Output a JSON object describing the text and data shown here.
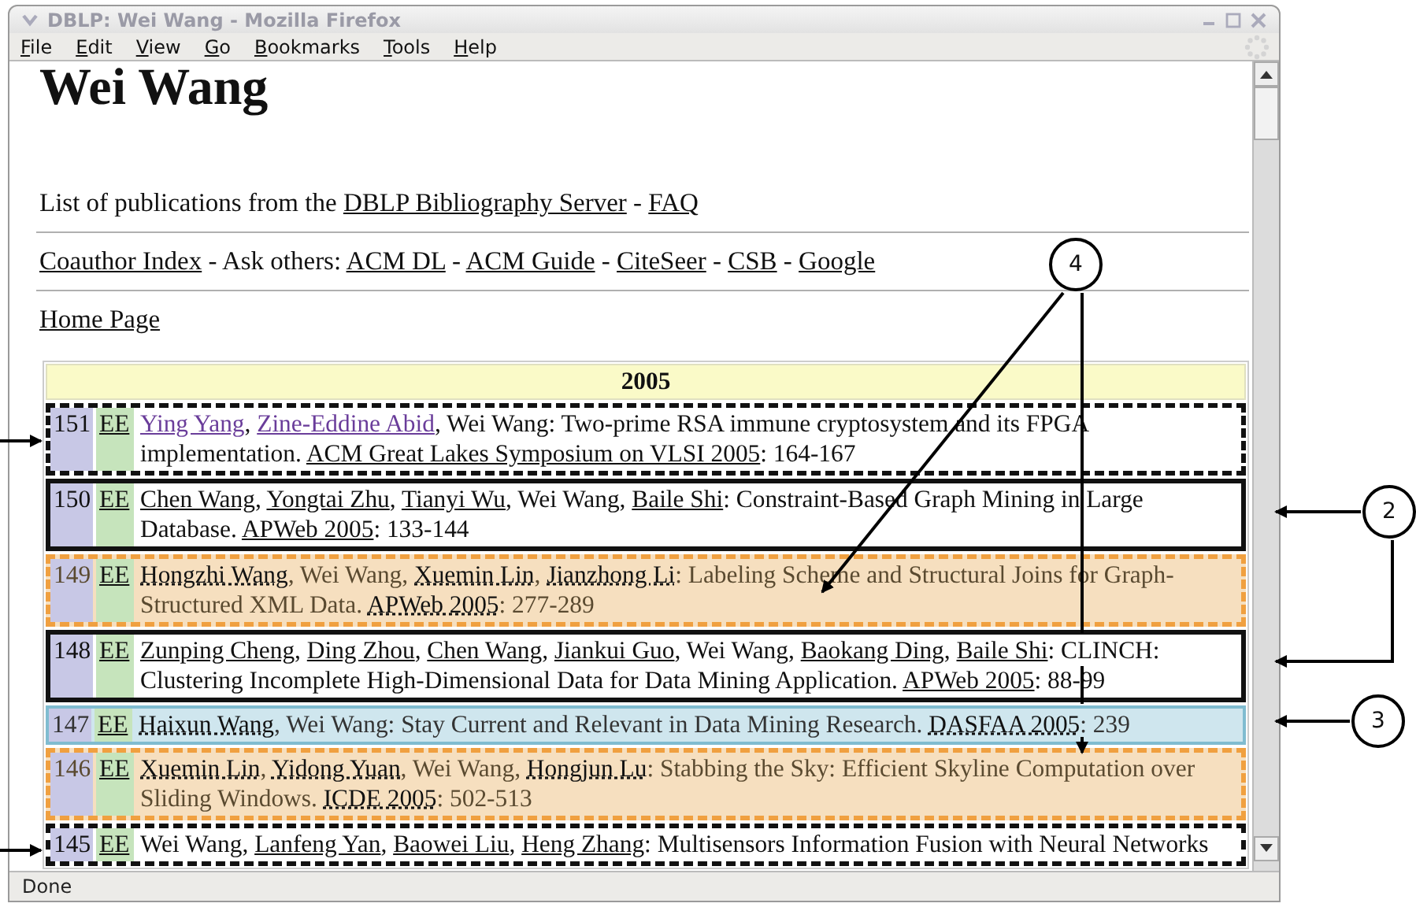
{
  "window": {
    "title": "DBLP: Wei Wang - Mozilla Firefox"
  },
  "menu": [
    {
      "label": "File"
    },
    {
      "label": "Edit"
    },
    {
      "label": "View"
    },
    {
      "label": "Go"
    },
    {
      "label": "Bookmarks"
    },
    {
      "label": "Tools"
    },
    {
      "label": "Help"
    }
  ],
  "page": {
    "heading": "Wei Wang",
    "lines": [
      [
        {
          "text": "List of publications from the ",
          "kind": "text"
        },
        {
          "text": "DBLP Bibliography Server",
          "kind": "link"
        },
        {
          "text": " - ",
          "kind": "text"
        },
        {
          "text": "FAQ",
          "kind": "link"
        }
      ],
      [
        {
          "text": "Coauthor Index",
          "kind": "link"
        },
        {
          "text": " - Ask others: ",
          "kind": "text"
        },
        {
          "text": "ACM DL",
          "kind": "link"
        },
        {
          "text": " - ",
          "kind": "text"
        },
        {
          "text": "ACM Guide",
          "kind": "link"
        },
        {
          "text": " - ",
          "kind": "text"
        },
        {
          "text": "CiteSeer",
          "kind": "link"
        },
        {
          "text": " - ",
          "kind": "text"
        },
        {
          "text": "CSB",
          "kind": "link"
        },
        {
          "text": " - ",
          "kind": "text"
        },
        {
          "text": "Google",
          "kind": "link"
        }
      ],
      [
        {
          "text": "Home Page",
          "kind": "link"
        }
      ]
    ]
  },
  "table": {
    "year": "2005",
    "rows": [
      {
        "number": "151",
        "ee": "EE",
        "kind": "dashed",
        "segments": [
          {
            "text": "Ying Yang",
            "kind": "author",
            "visited": true
          },
          {
            "text": ", ",
            "kind": "text"
          },
          {
            "text": "Zine-Eddine Abid",
            "kind": "author",
            "visited": true
          },
          {
            "text": ", Wei Wang: Two-prime RSA immune cryptosystem and its FPGA implementation. ",
            "kind": "text"
          },
          {
            "text": "ACM Great Lakes Symposium on VLSI 2005",
            "kind": "venue",
            "visited": false
          },
          {
            "text": ": 164-167",
            "kind": "text"
          }
        ]
      },
      {
        "number": "150",
        "ee": "EE",
        "kind": "solid",
        "segments": [
          {
            "text": "Chen Wang",
            "kind": "author",
            "visited": false
          },
          {
            "text": ", ",
            "kind": "text"
          },
          {
            "text": "Yongtai Zhu",
            "kind": "author",
            "visited": false
          },
          {
            "text": ", ",
            "kind": "text"
          },
          {
            "text": "Tianyi Wu",
            "kind": "author",
            "visited": false
          },
          {
            "text": ", Wei Wang, ",
            "kind": "text"
          },
          {
            "text": "Baile Shi",
            "kind": "author",
            "visited": false
          },
          {
            "text": ": Constraint-Based Graph Mining in Large Database. ",
            "kind": "text"
          },
          {
            "text": "APWeb 2005",
            "kind": "venue",
            "visited": false
          },
          {
            "text": ": 133-144",
            "kind": "text"
          }
        ]
      },
      {
        "number": "149",
        "ee": "EE",
        "kind": "orange",
        "segments": [
          {
            "text": "Hongzhi Wang",
            "kind": "author",
            "visited": false
          },
          {
            "text": ", Wei Wang, ",
            "kind": "text"
          },
          {
            "text": "Xuemin Lin",
            "kind": "author",
            "visited": false
          },
          {
            "text": ", ",
            "kind": "text"
          },
          {
            "text": "Jianzhong Li",
            "kind": "author",
            "visited": false
          },
          {
            "text": ": Labeling Scheme and Structural Joins for Graph-Structured XML Data. ",
            "kind": "text"
          },
          {
            "text": "APWeb 2005",
            "kind": "venue",
            "visited": false
          },
          {
            "text": ": 277-289",
            "kind": "text"
          }
        ]
      },
      {
        "number": "148",
        "ee": "EE",
        "kind": "solid",
        "segments": [
          {
            "text": "Zunping Cheng",
            "kind": "author",
            "visited": false
          },
          {
            "text": ", ",
            "kind": "text"
          },
          {
            "text": "Ding Zhou",
            "kind": "author",
            "visited": false
          },
          {
            "text": ", ",
            "kind": "text"
          },
          {
            "text": "Chen Wang",
            "kind": "author",
            "visited": false
          },
          {
            "text": ", ",
            "kind": "text"
          },
          {
            "text": "Jiankui Guo",
            "kind": "author",
            "visited": false
          },
          {
            "text": ", Wei Wang, ",
            "kind": "text"
          },
          {
            "text": "Baokang Ding",
            "kind": "author",
            "visited": false
          },
          {
            "text": ", ",
            "kind": "text"
          },
          {
            "text": "Baile Shi",
            "kind": "author",
            "visited": false
          },
          {
            "text": ": CLINCH: Clustering Incomplete High-Dimensional Data for Data Mining Application. ",
            "kind": "text"
          },
          {
            "text": "APWeb 2005",
            "kind": "venue",
            "visited": false
          },
          {
            "text": ": 88-99",
            "kind": "text"
          }
        ]
      },
      {
        "number": "147",
        "ee": "EE",
        "kind": "blue",
        "segments": [
          {
            "text": "Haixun Wang",
            "kind": "author",
            "visited": false
          },
          {
            "text": ", Wei Wang: Stay Current and Relevant in Data Mining Research. ",
            "kind": "text"
          },
          {
            "text": "DASFAA 2005",
            "kind": "venue",
            "visited": false
          },
          {
            "text": ": 239",
            "kind": "text"
          }
        ]
      },
      {
        "number": "146",
        "ee": "EE",
        "kind": "orange",
        "segments": [
          {
            "text": "Xuemin Lin",
            "kind": "author",
            "visited": false
          },
          {
            "text": ", ",
            "kind": "text"
          },
          {
            "text": "Yidong Yuan",
            "kind": "author",
            "visited": false
          },
          {
            "text": ", Wei Wang, ",
            "kind": "text"
          },
          {
            "text": "Hongjun Lu",
            "kind": "author",
            "visited": false
          },
          {
            "text": ": Stabbing the Sky: Efficient Skyline Computation over Sliding Windows. ",
            "kind": "text"
          },
          {
            "text": "ICDE 2005",
            "kind": "venue",
            "visited": false
          },
          {
            "text": ": 502-513",
            "kind": "text"
          }
        ]
      },
      {
        "number": "145",
        "ee": "EE",
        "kind": "dashed",
        "segments": [
          {
            "text": "Wei Wang, ",
            "kind": "text"
          },
          {
            "text": "Lanfeng Yan",
            "kind": "author",
            "visited": false
          },
          {
            "text": ", ",
            "kind": "text"
          },
          {
            "text": "Baowei Liu",
            "kind": "author",
            "visited": false
          },
          {
            "text": ", ",
            "kind": "text"
          },
          {
            "text": "Heng Zhang",
            "kind": "author",
            "visited": false
          },
          {
            "text": ": Multisensors Information Fusion with Neural Networks",
            "kind": "text"
          }
        ]
      }
    ]
  },
  "status_bar": {
    "text": "Done"
  },
  "annotations": {
    "callouts": [
      {
        "label": "4"
      },
      {
        "label": "2"
      },
      {
        "label": "3"
      }
    ]
  }
}
